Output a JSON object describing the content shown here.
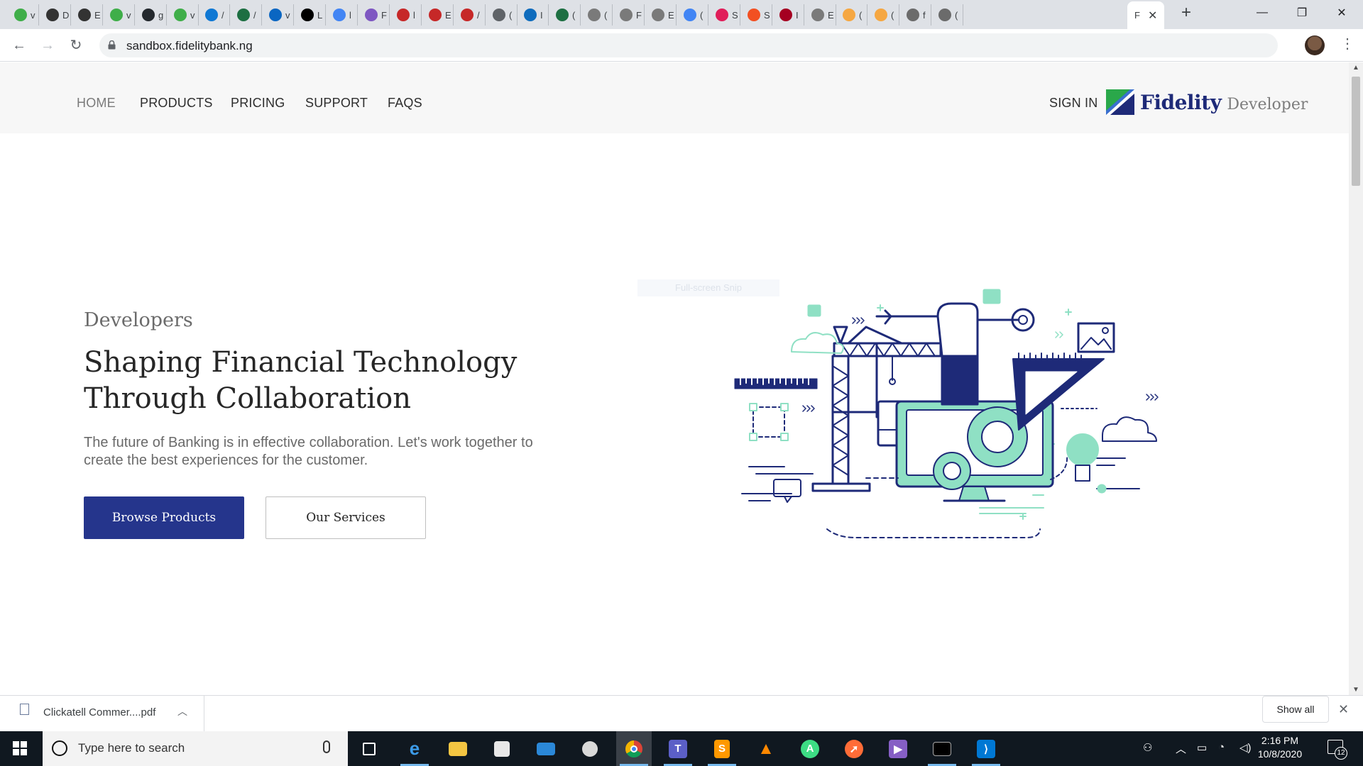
{
  "browser": {
    "tabs": [
      {
        "icon": "fidelity-icon",
        "letter": "v",
        "color": "#3fae49"
      },
      {
        "icon": "tool-icon",
        "letter": "D",
        "color": "#333333"
      },
      {
        "icon": "tool-icon",
        "letter": "E",
        "color": "#333333"
      },
      {
        "icon": "fidelity-icon",
        "letter": "v",
        "color": "#3fae49"
      },
      {
        "icon": "github-icon",
        "letter": "g",
        "color": "#24292e"
      },
      {
        "icon": "fidelity-icon",
        "letter": "v",
        "color": "#3fae49"
      },
      {
        "icon": "onedrive-icon",
        "letter": "/",
        "color": "#0f78d4"
      },
      {
        "icon": "excel-icon",
        "letter": "/",
        "color": "#1d6f42"
      },
      {
        "icon": "linkedin-icon",
        "letter": "v",
        "color": "#0a66c2"
      },
      {
        "icon": "medium-icon",
        "letter": "L",
        "color": "#000000"
      },
      {
        "icon": "google-icon",
        "letter": "l",
        "color": "#4285f4"
      },
      {
        "icon": "purple-circle-icon",
        "letter": "F",
        "color": "#7e57c2"
      },
      {
        "icon": "doc-icon",
        "letter": "l",
        "color": "#c62828"
      },
      {
        "icon": "doc-icon",
        "letter": "E",
        "color": "#c62828"
      },
      {
        "icon": "doc-icon",
        "letter": "/",
        "color": "#c62828"
      },
      {
        "icon": "list-icon",
        "letter": "(",
        "color": "#5f6368"
      },
      {
        "icon": "outlook-icon",
        "letter": "I",
        "color": "#0f6cbd"
      },
      {
        "icon": "excel-icon",
        "letter": "(",
        "color": "#1d6f42"
      },
      {
        "icon": "t-circle-icon",
        "letter": "(",
        "color": "#7a7a7a"
      },
      {
        "icon": "t-circle-icon",
        "letter": "F",
        "color": "#7a7a7a"
      },
      {
        "icon": "t-circle-icon",
        "letter": "E",
        "color": "#7a7a7a"
      },
      {
        "icon": "google-icon",
        "letter": "(",
        "color": "#4285f4"
      },
      {
        "icon": "slack-icon",
        "letter": "S",
        "color": "#e01e5a"
      },
      {
        "icon": "microsoft-icon",
        "letter": "S",
        "color": "#f25022"
      },
      {
        "icon": "iw-icon",
        "letter": "I",
        "color": "#a50021"
      },
      {
        "icon": "t-circle-icon",
        "letter": "E",
        "color": "#7a7a7a"
      },
      {
        "icon": "hand-icon",
        "letter": "(",
        "color": "#f5a742"
      },
      {
        "icon": "hand-icon",
        "letter": "(",
        "color": "#f5a742"
      },
      {
        "icon": "globe-icon",
        "letter": "f",
        "color": "#6b6b6b"
      },
      {
        "icon": "globe-icon",
        "letter": "(",
        "color": "#6b6b6b"
      }
    ],
    "active_tab_letter": "F",
    "url": "sandbox.fidelitybank.ng"
  },
  "site": {
    "nav": {
      "home": "HOME",
      "products": "PRODUCTS",
      "pricing": "PRICING",
      "support": "SUPPORT",
      "faqs": "FAQS",
      "sign_in": "SIGN IN"
    },
    "logo": {
      "name": "Fidelity",
      "suffix": "Developer"
    },
    "hero": {
      "kicker": "Developers",
      "headline": "Shaping Financial Technology Through Collaboration",
      "description": "The future of Banking is in effective collaboration. Let's work together to create the best experiences for the customer.",
      "primary_button": "Browse Products",
      "secondary_button": "Our Services"
    },
    "snip_overlay": "Full-screen Snip"
  },
  "downloads": {
    "file_name": "Clickatell Commer....pdf",
    "show_all": "Show all"
  },
  "taskbar": {
    "search_placeholder": "Type here to search",
    "time": "2:16 PM",
    "date": "10/8/2020",
    "notification_count": "12"
  },
  "colors": {
    "brand_navy": "#25358c",
    "brand_green": "#3fae49",
    "illustration_mint": "#8fe0c4"
  }
}
